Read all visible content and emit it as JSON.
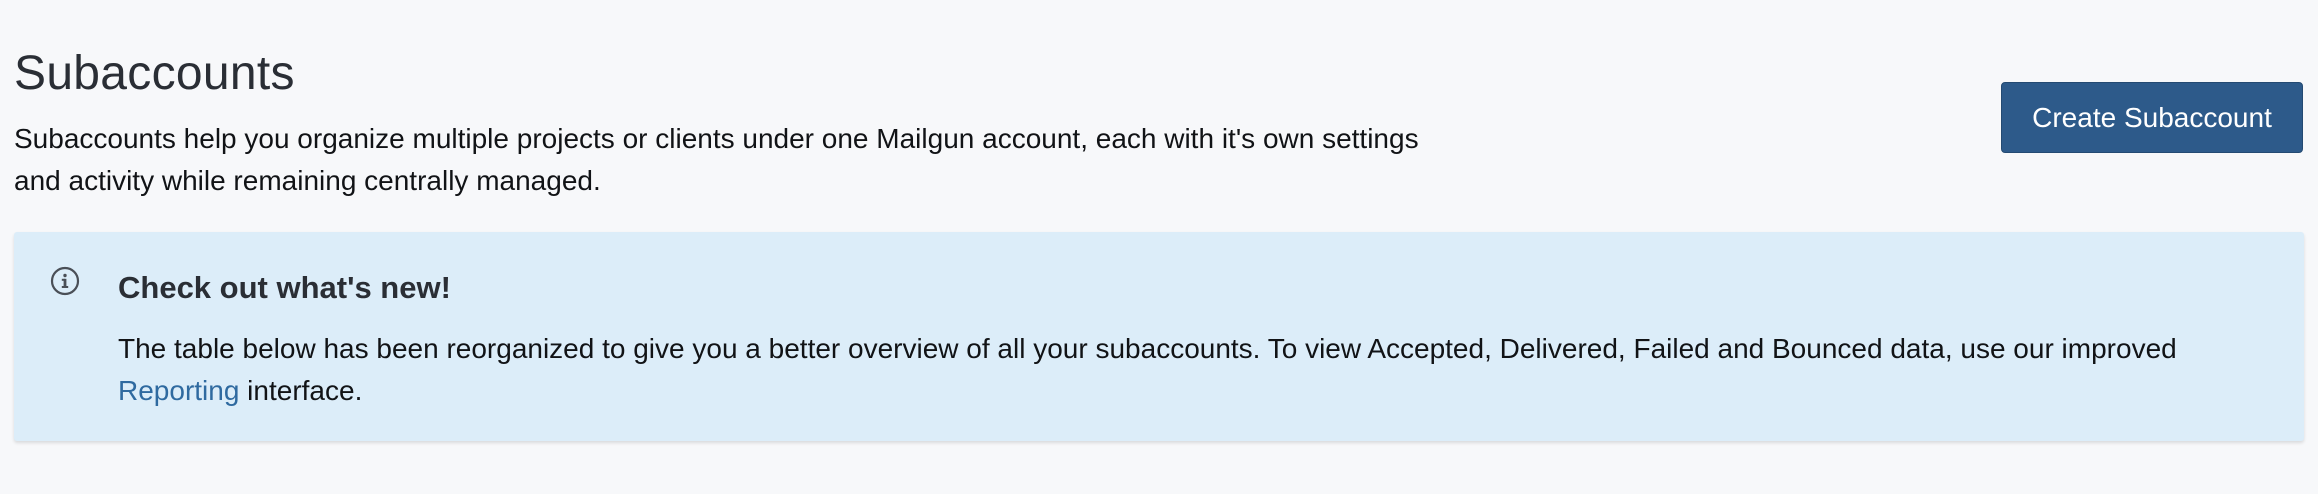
{
  "header": {
    "title": "Subaccounts",
    "description": "Subaccounts help you organize multiple projects or clients under one Mailgun account, each with it's own settings and activity while remaining centrally managed.",
    "create_button_label": "Create Subaccount"
  },
  "notice": {
    "icon": "info-circle-icon",
    "title": "Check out what's new!",
    "body_before_link": "The table below has been reorganized to give you a better overview of all your subaccounts. To view Accepted, Delivered, Failed and Bounced data, use our improved ",
    "link_label": "Reporting",
    "body_after_link": " interface."
  },
  "colors": {
    "page_background": "#f7f8fa",
    "primary_button": "#2d5a8a",
    "notice_background": "#dcedf9",
    "link": "#2f6aa0"
  }
}
